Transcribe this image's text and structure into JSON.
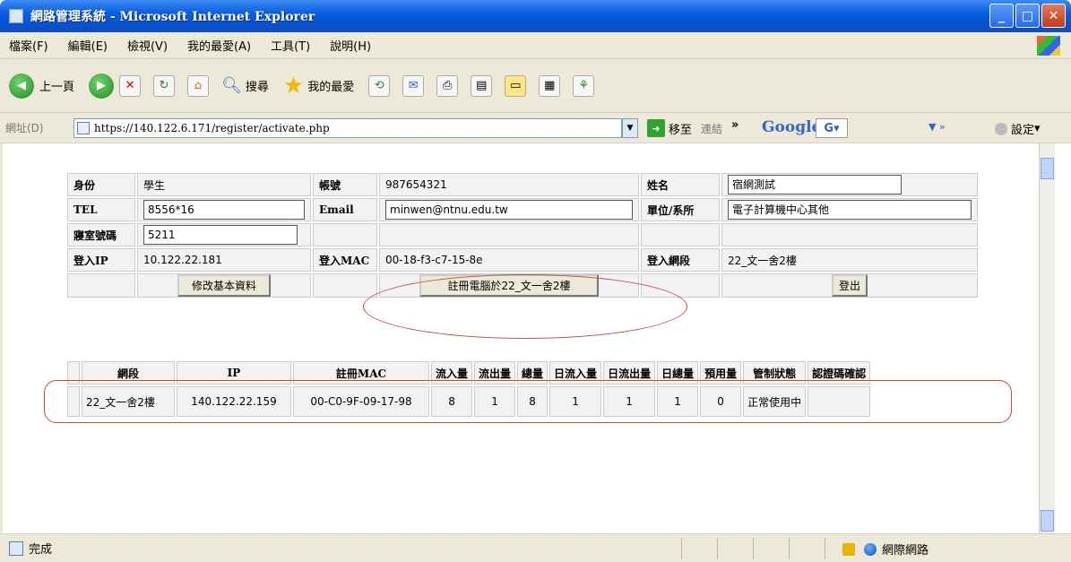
{
  "window": {
    "title": "網路管理系統 - Microsoft Internet Explorer",
    "controls": [
      "minimize",
      "maximize",
      "close"
    ]
  },
  "menubar": {
    "items": [
      "檔案(F)",
      "編輯(E)",
      "檢視(V)",
      "我的最愛(A)",
      "工具(T)",
      "說明(H)"
    ]
  },
  "toolbar": {
    "back_label": "上一頁",
    "search_label": "搜尋",
    "favorites_label": "我的最愛"
  },
  "addressbar": {
    "label": "網址(D)",
    "url": "https://140.122.6.171/register/activate.php",
    "go_label": "移至",
    "links_label": "連結",
    "overflow": "»",
    "google_label": "Google",
    "google_button": "G",
    "settings_label": "設定"
  },
  "info": {
    "identity_label": "身份",
    "identity_value": "學生",
    "account_label": "帳號",
    "account_value": "987654321",
    "name_label": "姓名",
    "name_value": "宿網測試",
    "tel_label": "TEL",
    "tel_value": "8556*16",
    "email_label": "Email",
    "email_value": "minwen@ntnu.edu.tw",
    "dept_label": "單位/系所",
    "dept_value": "電子計算機中心其他",
    "room_label": "寢室號碼",
    "room_value": "5211",
    "login_ip_label": "登入IP",
    "login_ip_value": "10.122.22.181",
    "login_mac_label": "登入MAC",
    "login_mac_value": "00-18-f3-c7-15-8e",
    "login_seg_label": "登入網段",
    "login_seg_value": "22_文一舍2樓",
    "edit_button": "修改基本資料",
    "register_button": "註冊電腦於22_文一舍2樓",
    "logout_button": "登出"
  },
  "stats": {
    "headers": [
      "網段",
      "IP",
      "註冊MAC",
      "流入量",
      "流出量",
      "總量",
      "日流入量",
      "日流出量",
      "日總量",
      "預用量",
      "管制狀態",
      "認證碼確認"
    ],
    "row": [
      "22_文一舍2樓",
      "140.122.22.159",
      "00-C0-9F-09-17-98",
      "8",
      "1",
      "8",
      "1",
      "1",
      "1",
      "0",
      "正常使用中",
      ""
    ]
  },
  "statusbar": {
    "text": "完成",
    "zone": "網際網路"
  }
}
